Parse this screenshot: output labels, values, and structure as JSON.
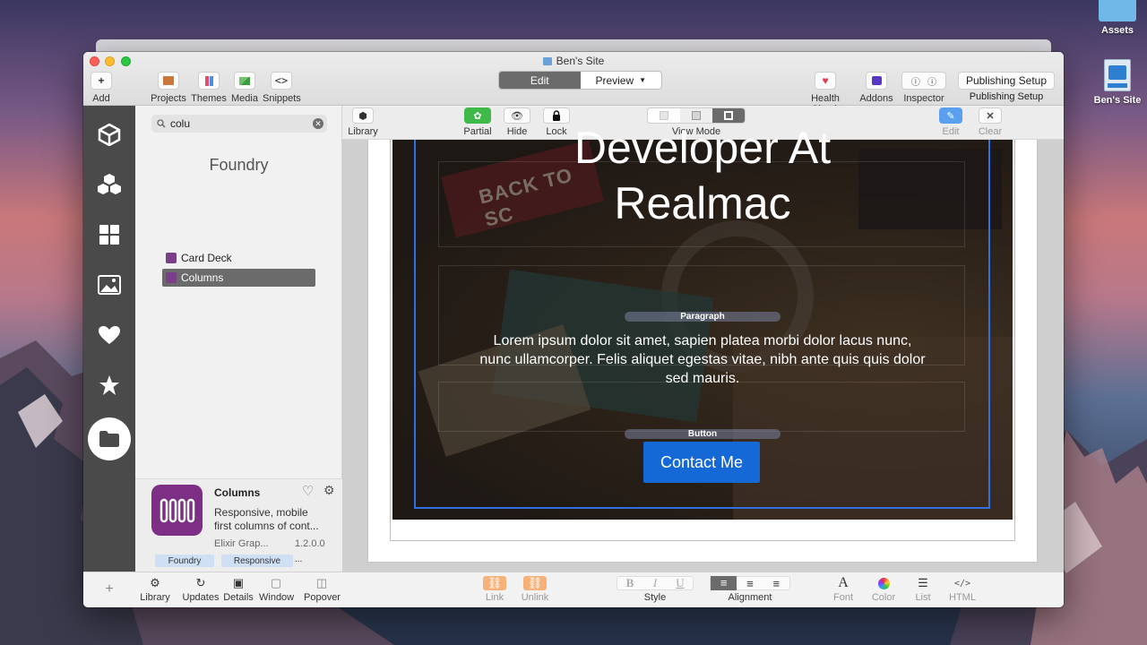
{
  "desktop": {
    "icons": [
      {
        "label": "Assets"
      },
      {
        "label": "Ben's Site"
      }
    ]
  },
  "window": {
    "title": "Ben's Site",
    "toolbar": {
      "add": "Add",
      "projects": "Projects",
      "themes": "Themes",
      "media": "Media",
      "snippets": "Snippets",
      "mode_edit": "Edit",
      "mode_preview": "Preview",
      "health_check": "Health Check",
      "addons": "Addons",
      "inspector": "Inspector",
      "publishing_button": "Publishing Setup",
      "publishing_label": "Publishing Setup"
    }
  },
  "library": {
    "search_value": "colu",
    "heading": "Foundry",
    "items": [
      {
        "label": "Card Deck"
      },
      {
        "label": "Columns"
      }
    ],
    "selected": {
      "name": "Columns",
      "description_line1": "Responsive, mobile",
      "description_line2": "first columns of cont...",
      "author": "Elixir Grap...",
      "version": "1.2.0.0",
      "tags": [
        "Foundry",
        "Responsive",
        "..."
      ]
    }
  },
  "editor_toolbar": {
    "library": "Library",
    "partial": "Partial",
    "hide": "Hide",
    "lock": "Lock",
    "view_mode": "View Mode",
    "edit": "Edit",
    "clear": "Clear"
  },
  "page": {
    "title_line1": "Developer At",
    "title_line2": "Realmac",
    "paragraph_label": "Paragraph",
    "paragraph_line1": "Lorem ipsum dolor sit amet, sapien platea morbi dolor lacus nunc,",
    "paragraph_line2": "nunc ullamcorper. Felis aliquet egestas vitae, nibh ante quis quis dolor",
    "paragraph_line3": "sed mauris.",
    "button_label": "Button",
    "button_text": "Contact Me",
    "pennant_text": "BACK TO SC"
  },
  "bottom_bar": {
    "library": "Library",
    "updates": "Updates",
    "details": "Details",
    "window": "Window",
    "popover": "Popover",
    "link": "Link",
    "unlink": "Unlink",
    "style": "Style",
    "alignment": "Alignment",
    "font": "Font",
    "color": "Color",
    "list": "List",
    "html": "HTML"
  },
  "colors": {
    "accent": "#1469d6",
    "selection_frame": "#2f6fe0",
    "sidebar_dark": "#4a4a4a",
    "component_purple": "#7d2f86"
  }
}
